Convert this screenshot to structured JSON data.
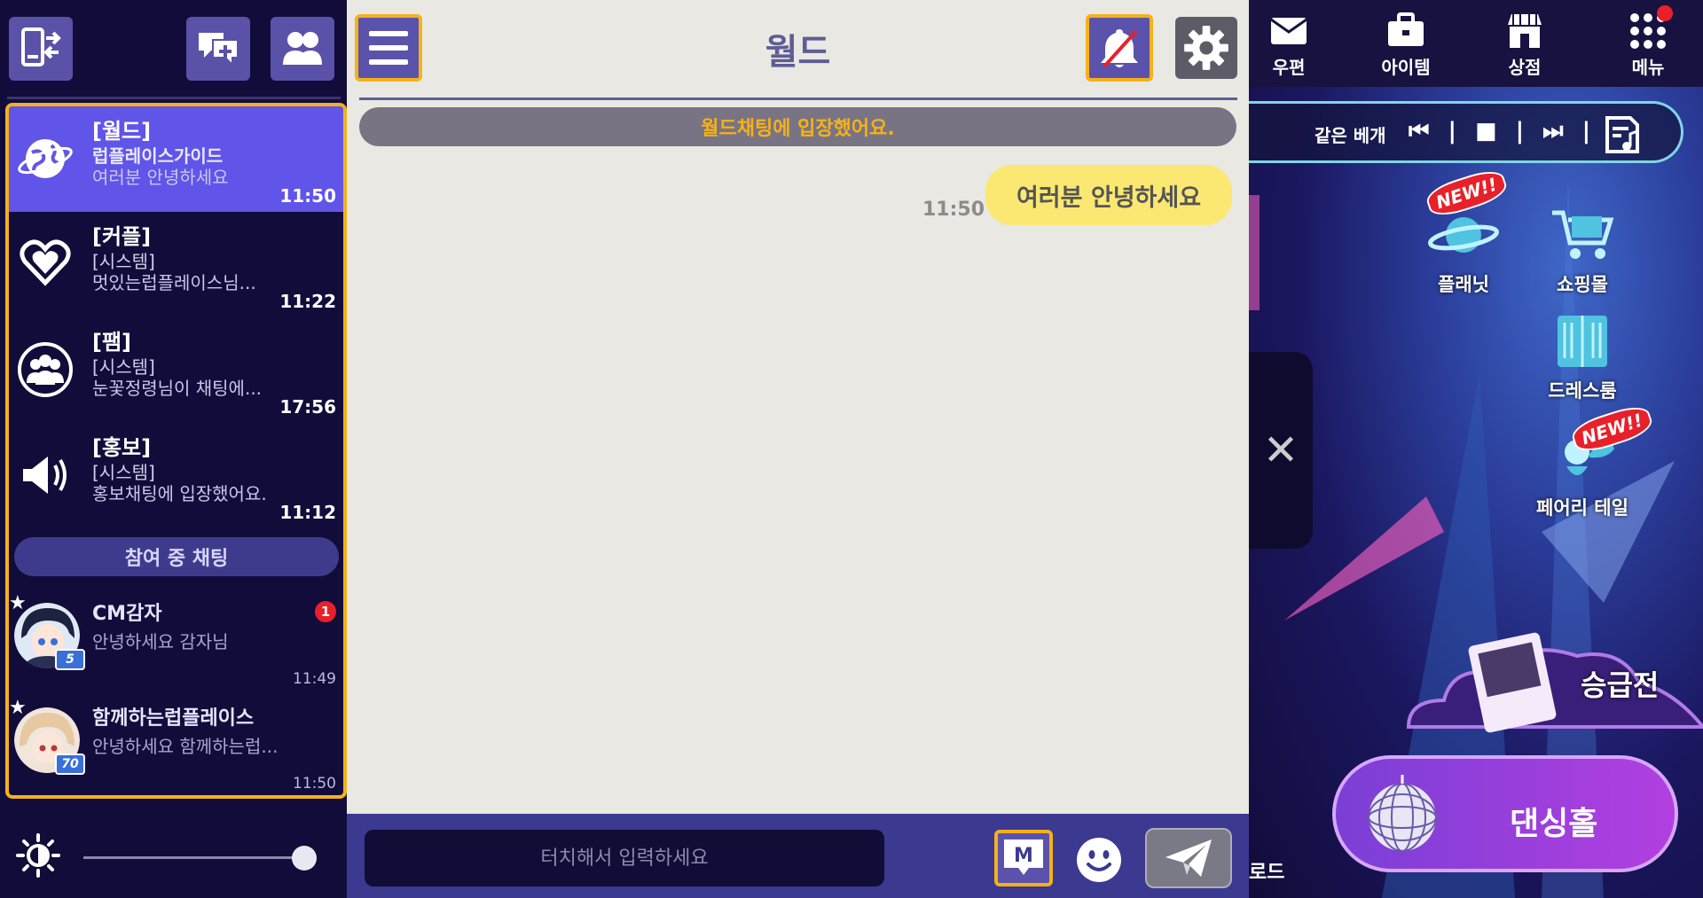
{
  "left_panel": {
    "chat_rooms": [
      {
        "name": "[월드]",
        "sender": "럽플레이스가이드",
        "message": "여러분 안녕하세요",
        "time": "11:50",
        "icon": "globe-icon",
        "active": true
      },
      {
        "name": "[커플]",
        "sender": "[시스템]",
        "message": "멋있는럽플레이스님...",
        "time": "11:22",
        "icon": "heart-icon",
        "active": false
      },
      {
        "name": "[팸]",
        "sender": "[시스템]",
        "message": "눈꽃정령님이 채팅에...",
        "time": "17:56",
        "icon": "group-icon",
        "active": false
      },
      {
        "name": "[홍보]",
        "sender": "[시스템]",
        "message": "홍보채팅에 입장했어요.",
        "time": "11:12",
        "icon": "megaphone-icon",
        "active": false
      }
    ],
    "joined_header": "참여 중 채팅",
    "direct_chats": [
      {
        "name": "CM감자",
        "message": "안녕하세요 감자님",
        "time": "11:49",
        "level": "5",
        "unread": "1"
      },
      {
        "name": "함께하는럽플레이스",
        "message": "안녕하세요 함께하는럽...",
        "time": "11:50",
        "level": "70",
        "unread": ""
      }
    ],
    "brightness": 0.95
  },
  "center_panel": {
    "title": "월드",
    "system_notice": "월드채팅에 입장했어요.",
    "my_message": {
      "text": "여러분 안녕하세요",
      "time": "11:50"
    },
    "input_placeholder": "터치해서 입력하세요",
    "macro_label": "M"
  },
  "right_panel": {
    "top_icons": [
      {
        "label": "우편",
        "icon": "mail-icon"
      },
      {
        "label": "아이템",
        "icon": "briefcase-icon"
      },
      {
        "label": "상점",
        "icon": "store-icon"
      },
      {
        "label": "메뉴",
        "icon": "grid-menu-icon"
      }
    ],
    "music_title": "같은 베개",
    "music_controls": "⏮ | ■ | ⏭ |",
    "menu_items": [
      {
        "label": "플래닛",
        "new": true
      },
      {
        "label": "쇼핑몰",
        "new": false
      },
      {
        "label": "드레스룸",
        "new": false
      },
      {
        "label": "페어리 테일",
        "new": true
      }
    ],
    "new_tag": "NEW!!",
    "promotion_label": "승급전",
    "dance_hall_label": "댄싱홀",
    "road_label": "로드",
    "close_label": "✕"
  },
  "colors": {
    "accent_yellow": "#f5b11a",
    "active_room": "#6055e8",
    "panel_dark": "#120c3a",
    "chat_bg": "#e9e8e2",
    "my_bubble": "#fbe872"
  }
}
